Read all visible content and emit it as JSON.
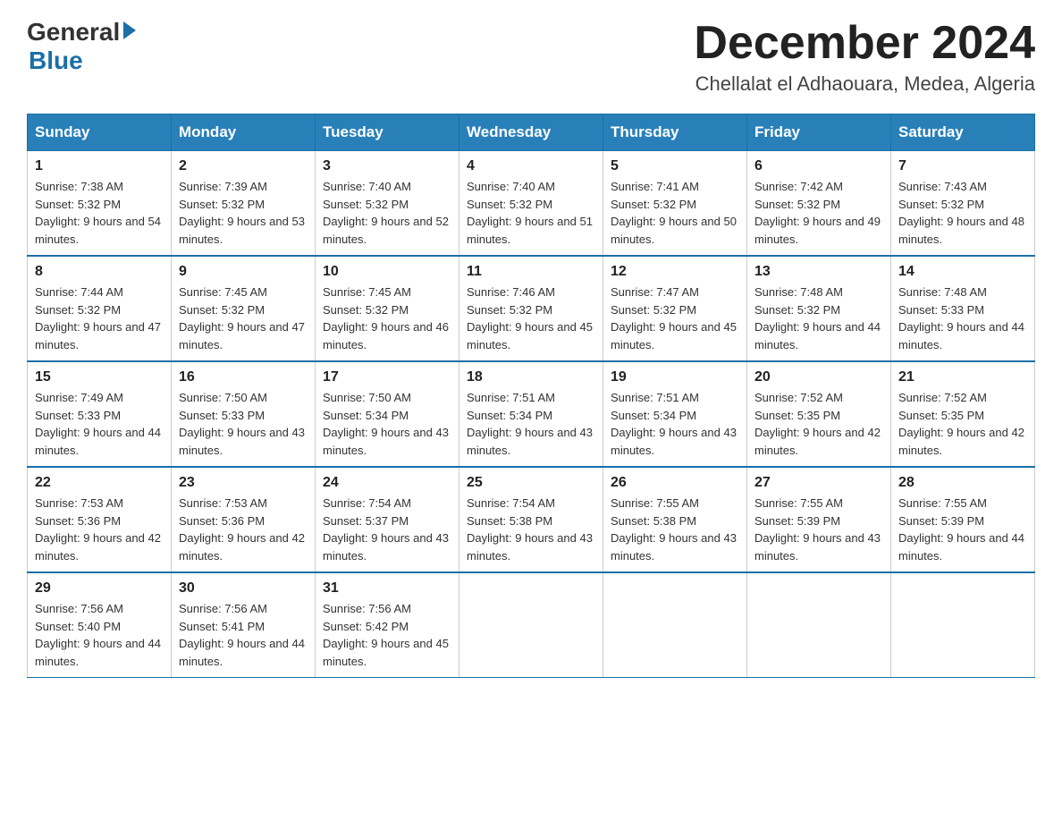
{
  "logo": {
    "general": "General",
    "blue": "Blue"
  },
  "title": "December 2024",
  "location": "Chellalat el Adhaouara, Medea, Algeria",
  "days_of_week": [
    "Sunday",
    "Monday",
    "Tuesday",
    "Wednesday",
    "Thursday",
    "Friday",
    "Saturday"
  ],
  "weeks": [
    [
      {
        "day": 1,
        "sunrise": "7:38 AM",
        "sunset": "5:32 PM",
        "daylight": "9 hours and 54 minutes"
      },
      {
        "day": 2,
        "sunrise": "7:39 AM",
        "sunset": "5:32 PM",
        "daylight": "9 hours and 53 minutes"
      },
      {
        "day": 3,
        "sunrise": "7:40 AM",
        "sunset": "5:32 PM",
        "daylight": "9 hours and 52 minutes"
      },
      {
        "day": 4,
        "sunrise": "7:40 AM",
        "sunset": "5:32 PM",
        "daylight": "9 hours and 51 minutes"
      },
      {
        "day": 5,
        "sunrise": "7:41 AM",
        "sunset": "5:32 PM",
        "daylight": "9 hours and 50 minutes"
      },
      {
        "day": 6,
        "sunrise": "7:42 AM",
        "sunset": "5:32 PM",
        "daylight": "9 hours and 49 minutes"
      },
      {
        "day": 7,
        "sunrise": "7:43 AM",
        "sunset": "5:32 PM",
        "daylight": "9 hours and 48 minutes"
      }
    ],
    [
      {
        "day": 8,
        "sunrise": "7:44 AM",
        "sunset": "5:32 PM",
        "daylight": "9 hours and 47 minutes"
      },
      {
        "day": 9,
        "sunrise": "7:45 AM",
        "sunset": "5:32 PM",
        "daylight": "9 hours and 47 minutes"
      },
      {
        "day": 10,
        "sunrise": "7:45 AM",
        "sunset": "5:32 PM",
        "daylight": "9 hours and 46 minutes"
      },
      {
        "day": 11,
        "sunrise": "7:46 AM",
        "sunset": "5:32 PM",
        "daylight": "9 hours and 45 minutes"
      },
      {
        "day": 12,
        "sunrise": "7:47 AM",
        "sunset": "5:32 PM",
        "daylight": "9 hours and 45 minutes"
      },
      {
        "day": 13,
        "sunrise": "7:48 AM",
        "sunset": "5:32 PM",
        "daylight": "9 hours and 44 minutes"
      },
      {
        "day": 14,
        "sunrise": "7:48 AM",
        "sunset": "5:33 PM",
        "daylight": "9 hours and 44 minutes"
      }
    ],
    [
      {
        "day": 15,
        "sunrise": "7:49 AM",
        "sunset": "5:33 PM",
        "daylight": "9 hours and 44 minutes"
      },
      {
        "day": 16,
        "sunrise": "7:50 AM",
        "sunset": "5:33 PM",
        "daylight": "9 hours and 43 minutes"
      },
      {
        "day": 17,
        "sunrise": "7:50 AM",
        "sunset": "5:34 PM",
        "daylight": "9 hours and 43 minutes"
      },
      {
        "day": 18,
        "sunrise": "7:51 AM",
        "sunset": "5:34 PM",
        "daylight": "9 hours and 43 minutes"
      },
      {
        "day": 19,
        "sunrise": "7:51 AM",
        "sunset": "5:34 PM",
        "daylight": "9 hours and 43 minutes"
      },
      {
        "day": 20,
        "sunrise": "7:52 AM",
        "sunset": "5:35 PM",
        "daylight": "9 hours and 42 minutes"
      },
      {
        "day": 21,
        "sunrise": "7:52 AM",
        "sunset": "5:35 PM",
        "daylight": "9 hours and 42 minutes"
      }
    ],
    [
      {
        "day": 22,
        "sunrise": "7:53 AM",
        "sunset": "5:36 PM",
        "daylight": "9 hours and 42 minutes"
      },
      {
        "day": 23,
        "sunrise": "7:53 AM",
        "sunset": "5:36 PM",
        "daylight": "9 hours and 42 minutes"
      },
      {
        "day": 24,
        "sunrise": "7:54 AM",
        "sunset": "5:37 PM",
        "daylight": "9 hours and 43 minutes"
      },
      {
        "day": 25,
        "sunrise": "7:54 AM",
        "sunset": "5:38 PM",
        "daylight": "9 hours and 43 minutes"
      },
      {
        "day": 26,
        "sunrise": "7:55 AM",
        "sunset": "5:38 PM",
        "daylight": "9 hours and 43 minutes"
      },
      {
        "day": 27,
        "sunrise": "7:55 AM",
        "sunset": "5:39 PM",
        "daylight": "9 hours and 43 minutes"
      },
      {
        "day": 28,
        "sunrise": "7:55 AM",
        "sunset": "5:39 PM",
        "daylight": "9 hours and 44 minutes"
      }
    ],
    [
      {
        "day": 29,
        "sunrise": "7:56 AM",
        "sunset": "5:40 PM",
        "daylight": "9 hours and 44 minutes"
      },
      {
        "day": 30,
        "sunrise": "7:56 AM",
        "sunset": "5:41 PM",
        "daylight": "9 hours and 44 minutes"
      },
      {
        "day": 31,
        "sunrise": "7:56 AM",
        "sunset": "5:42 PM",
        "daylight": "9 hours and 45 minutes"
      },
      null,
      null,
      null,
      null
    ]
  ],
  "labels": {
    "sunrise": "Sunrise:",
    "sunset": "Sunset:",
    "daylight": "Daylight:"
  }
}
